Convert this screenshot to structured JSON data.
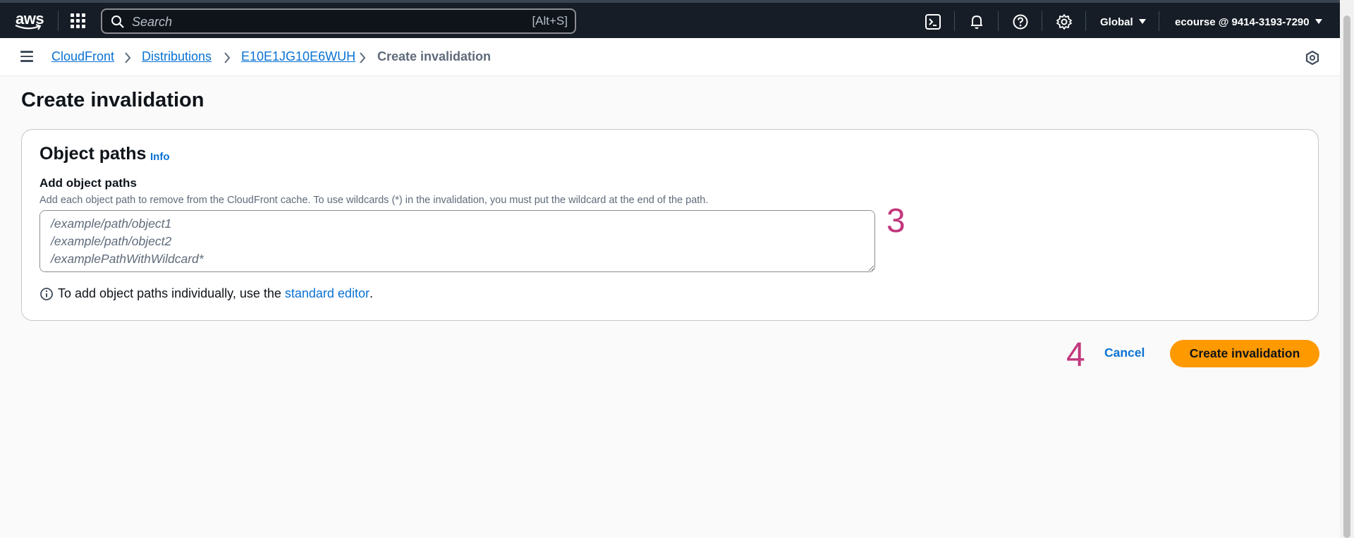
{
  "topnav": {
    "logo_text": "aws",
    "search_placeholder": "Search",
    "search_shortcut": "[Alt+S]",
    "icons": [
      "cloudshell-icon",
      "bell-icon",
      "help-icon",
      "gear-icon"
    ],
    "region": "Global",
    "account": "ecourse @ 9414-3193-7290"
  },
  "breadcrumb": {
    "items": [
      {
        "label": "CloudFront",
        "link": true
      },
      {
        "label": "Distributions",
        "link": true
      },
      {
        "label": "E10E1JG10E6WUH",
        "link": true
      },
      {
        "label": "Create invalidation",
        "link": false
      }
    ]
  },
  "page": {
    "title": "Create invalidation",
    "section_title": "Object paths",
    "info_label": "Info",
    "field_label": "Add object paths",
    "field_description": "Add each object path to remove from the CloudFront cache. To use wildcards (*) in the invalidation, you must put the wildcard at the end of the path.",
    "paths_placeholder": "/example/path/object1\n/example/path/object2\n/examplePathWithWildcard*",
    "tip_prefix": "To add object paths individually, use the ",
    "tip_link": "standard editor",
    "tip_suffix": ".",
    "cancel_label": "Cancel",
    "submit_label": "Create invalidation"
  },
  "annotations": {
    "step_3": "3",
    "step_4": "4"
  },
  "colors": {
    "nav_bg": "#161d26",
    "link": "#0972d3",
    "primary_button": "#ff9900",
    "annotation": "#c2377d"
  }
}
